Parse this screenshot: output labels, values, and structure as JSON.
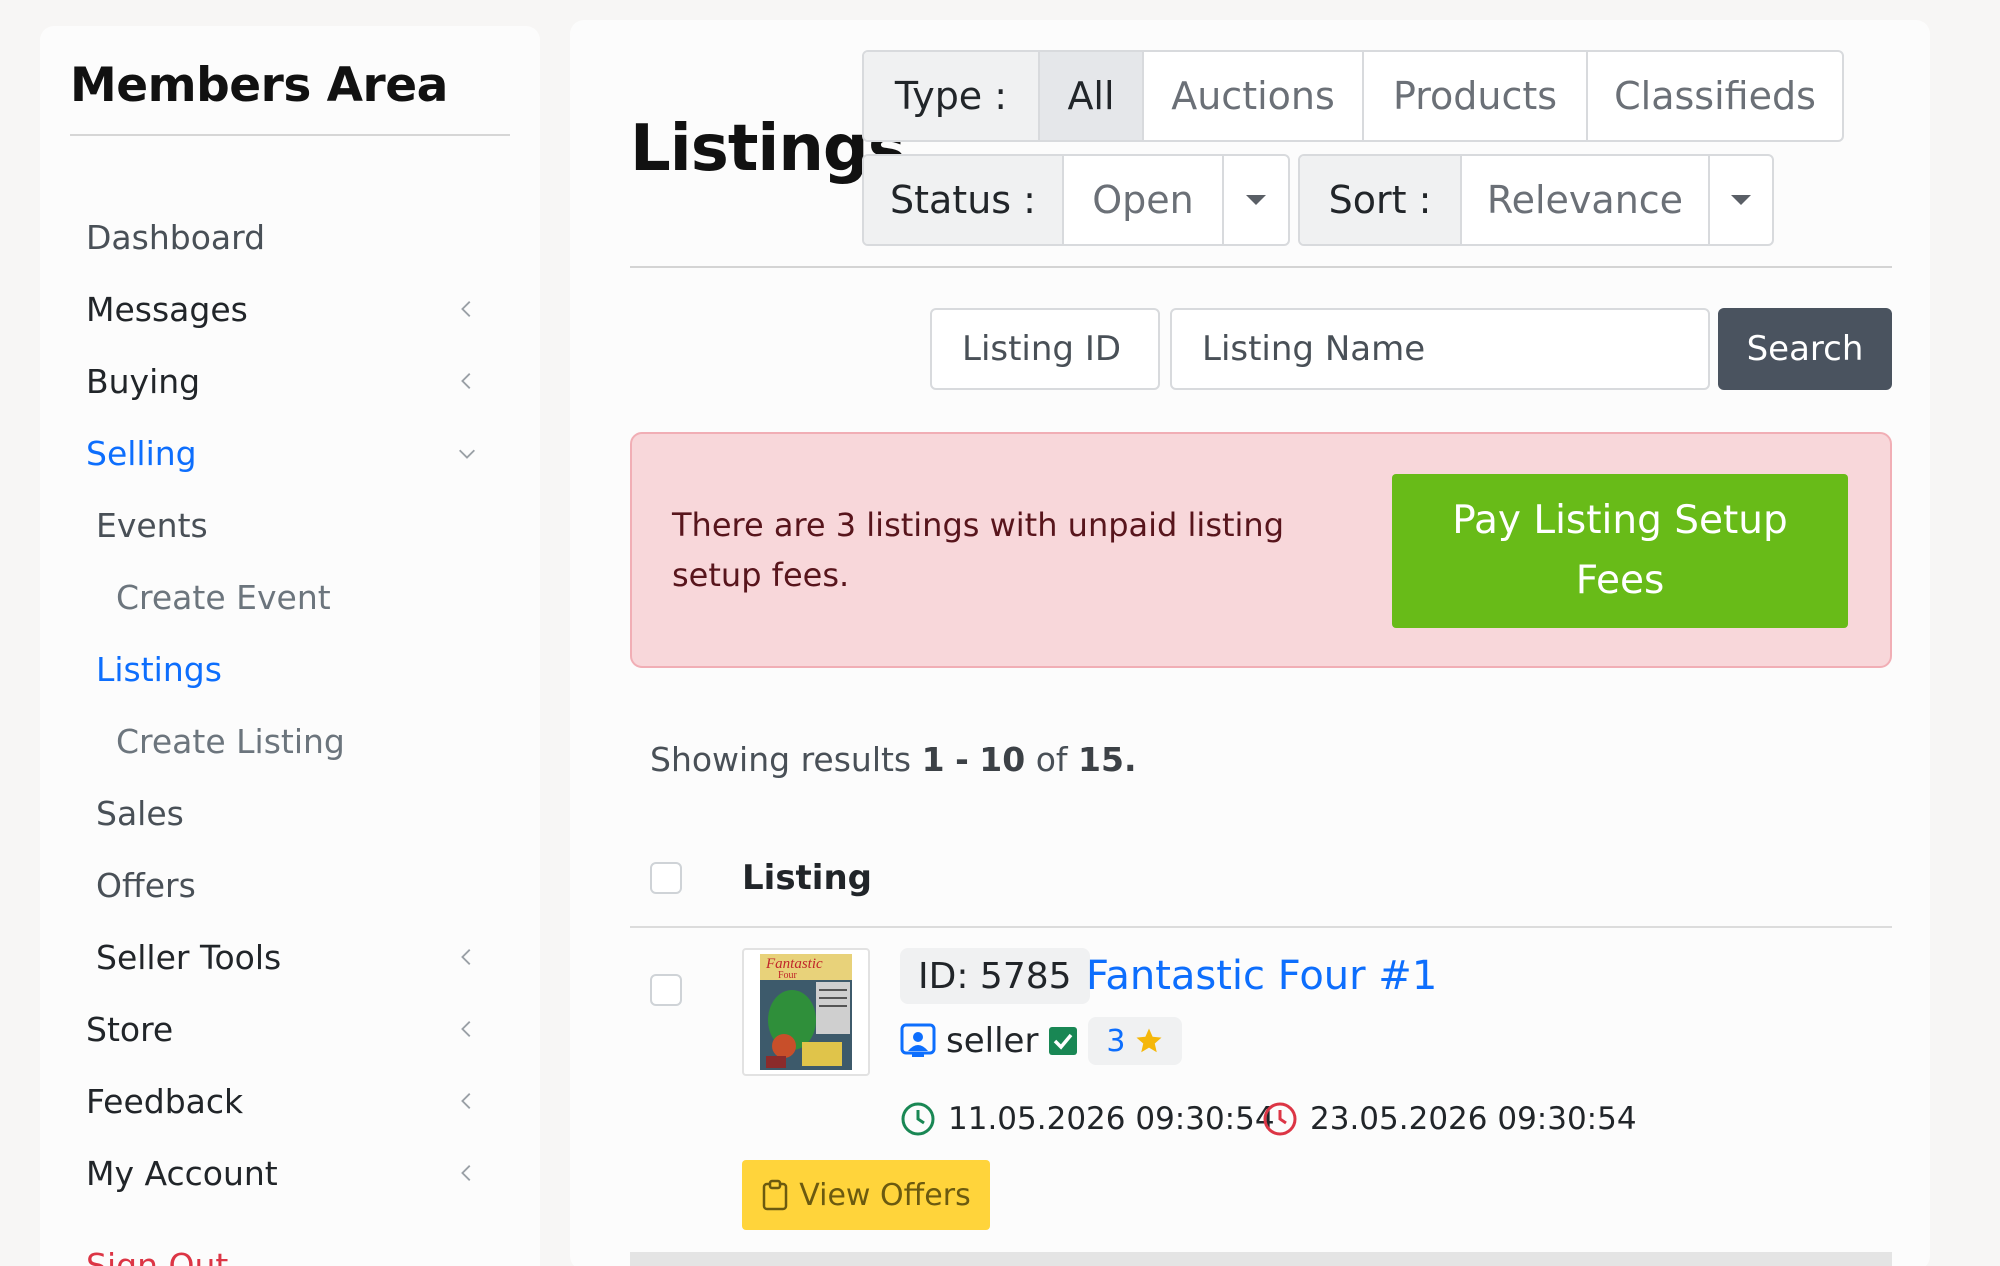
{
  "sidebar": {
    "title": "Members Area",
    "items": [
      {
        "label": "Dashboard",
        "color": "#495057",
        "indent": 0,
        "chevron": ""
      },
      {
        "label": "Messages",
        "color": "#212529",
        "indent": 0,
        "chevron": "left"
      },
      {
        "label": "Buying",
        "color": "#212529",
        "indent": 0,
        "chevron": "left"
      },
      {
        "label": "Selling",
        "color": "#0d6efd",
        "indent": 0,
        "chevron": "down"
      },
      {
        "label": "Events",
        "color": "#495057",
        "indent": 1,
        "chevron": ""
      },
      {
        "label": "Create Event",
        "color": "#6c757d",
        "indent": 2,
        "chevron": ""
      },
      {
        "label": "Listings",
        "color": "#0d6efd",
        "indent": 1,
        "chevron": ""
      },
      {
        "label": "Create Listing",
        "color": "#6c757d",
        "indent": 2,
        "chevron": ""
      },
      {
        "label": "Sales",
        "color": "#495057",
        "indent": 1,
        "chevron": ""
      },
      {
        "label": "Offers",
        "color": "#495057",
        "indent": 1,
        "chevron": ""
      },
      {
        "label": "Seller Tools",
        "color": "#212529",
        "indent": 1,
        "chevron": "left"
      },
      {
        "label": "Store",
        "color": "#212529",
        "indent": 0,
        "chevron": "left"
      },
      {
        "label": "Feedback",
        "color": "#212529",
        "indent": 0,
        "chevron": "left"
      },
      {
        "label": "My Account",
        "color": "#212529",
        "indent": 0,
        "chevron": "left"
      },
      {
        "label": "Sign Out",
        "color": "#dc3545",
        "indent": 0,
        "chevron": ""
      }
    ]
  },
  "header": {
    "title": "Listings",
    "type_filter": {
      "label": "Type :",
      "options": [
        "All",
        "Auctions",
        "Products",
        "Classifieds"
      ],
      "selected": "All"
    },
    "status_filter": {
      "label": "Status :",
      "value": "Open"
    },
    "sort_filter": {
      "label": "Sort :",
      "value": "Relevance"
    }
  },
  "search": {
    "id_placeholder": "Listing ID",
    "name_placeholder": "Listing Name",
    "button_label": "Search"
  },
  "alert": {
    "message": "There are 3 listings with unpaid listing setup fees.",
    "button_label": "Pay Listing Setup Fees"
  },
  "results": {
    "prefix": "Showing results",
    "from": "1",
    "dash": "-",
    "to": "10",
    "of_word": "of",
    "total": "15."
  },
  "table": {
    "header_listing": "Listing",
    "rows": [
      {
        "id_label": "ID: 5785",
        "title": "Fantastic Four #1",
        "seller": "seller",
        "rating": "3",
        "start": "11.05.2026 09:30:54",
        "end": "23.05.2026 09:30:54",
        "offers_label": "View Offers"
      }
    ]
  },
  "colors": {
    "link": "#0d6efd",
    "pay_button": "#68bb18",
    "search_button": "#4a535f",
    "offers_button": "#ffd43b",
    "alert_bg": "#f8d7da",
    "start_clock": "#198754",
    "end_clock": "#dc3545",
    "verified": "#198754",
    "star": "#f5b70a"
  },
  "icons": {
    "sidebar_collapsed": "chevron-left-icon",
    "sidebar_expanded": "chevron-down-icon",
    "seller": "user-badge-icon",
    "verified": "check-square-icon",
    "rating": "star-icon",
    "start": "clock-icon",
    "end": "clock-icon",
    "offers": "clipboard-icon"
  }
}
